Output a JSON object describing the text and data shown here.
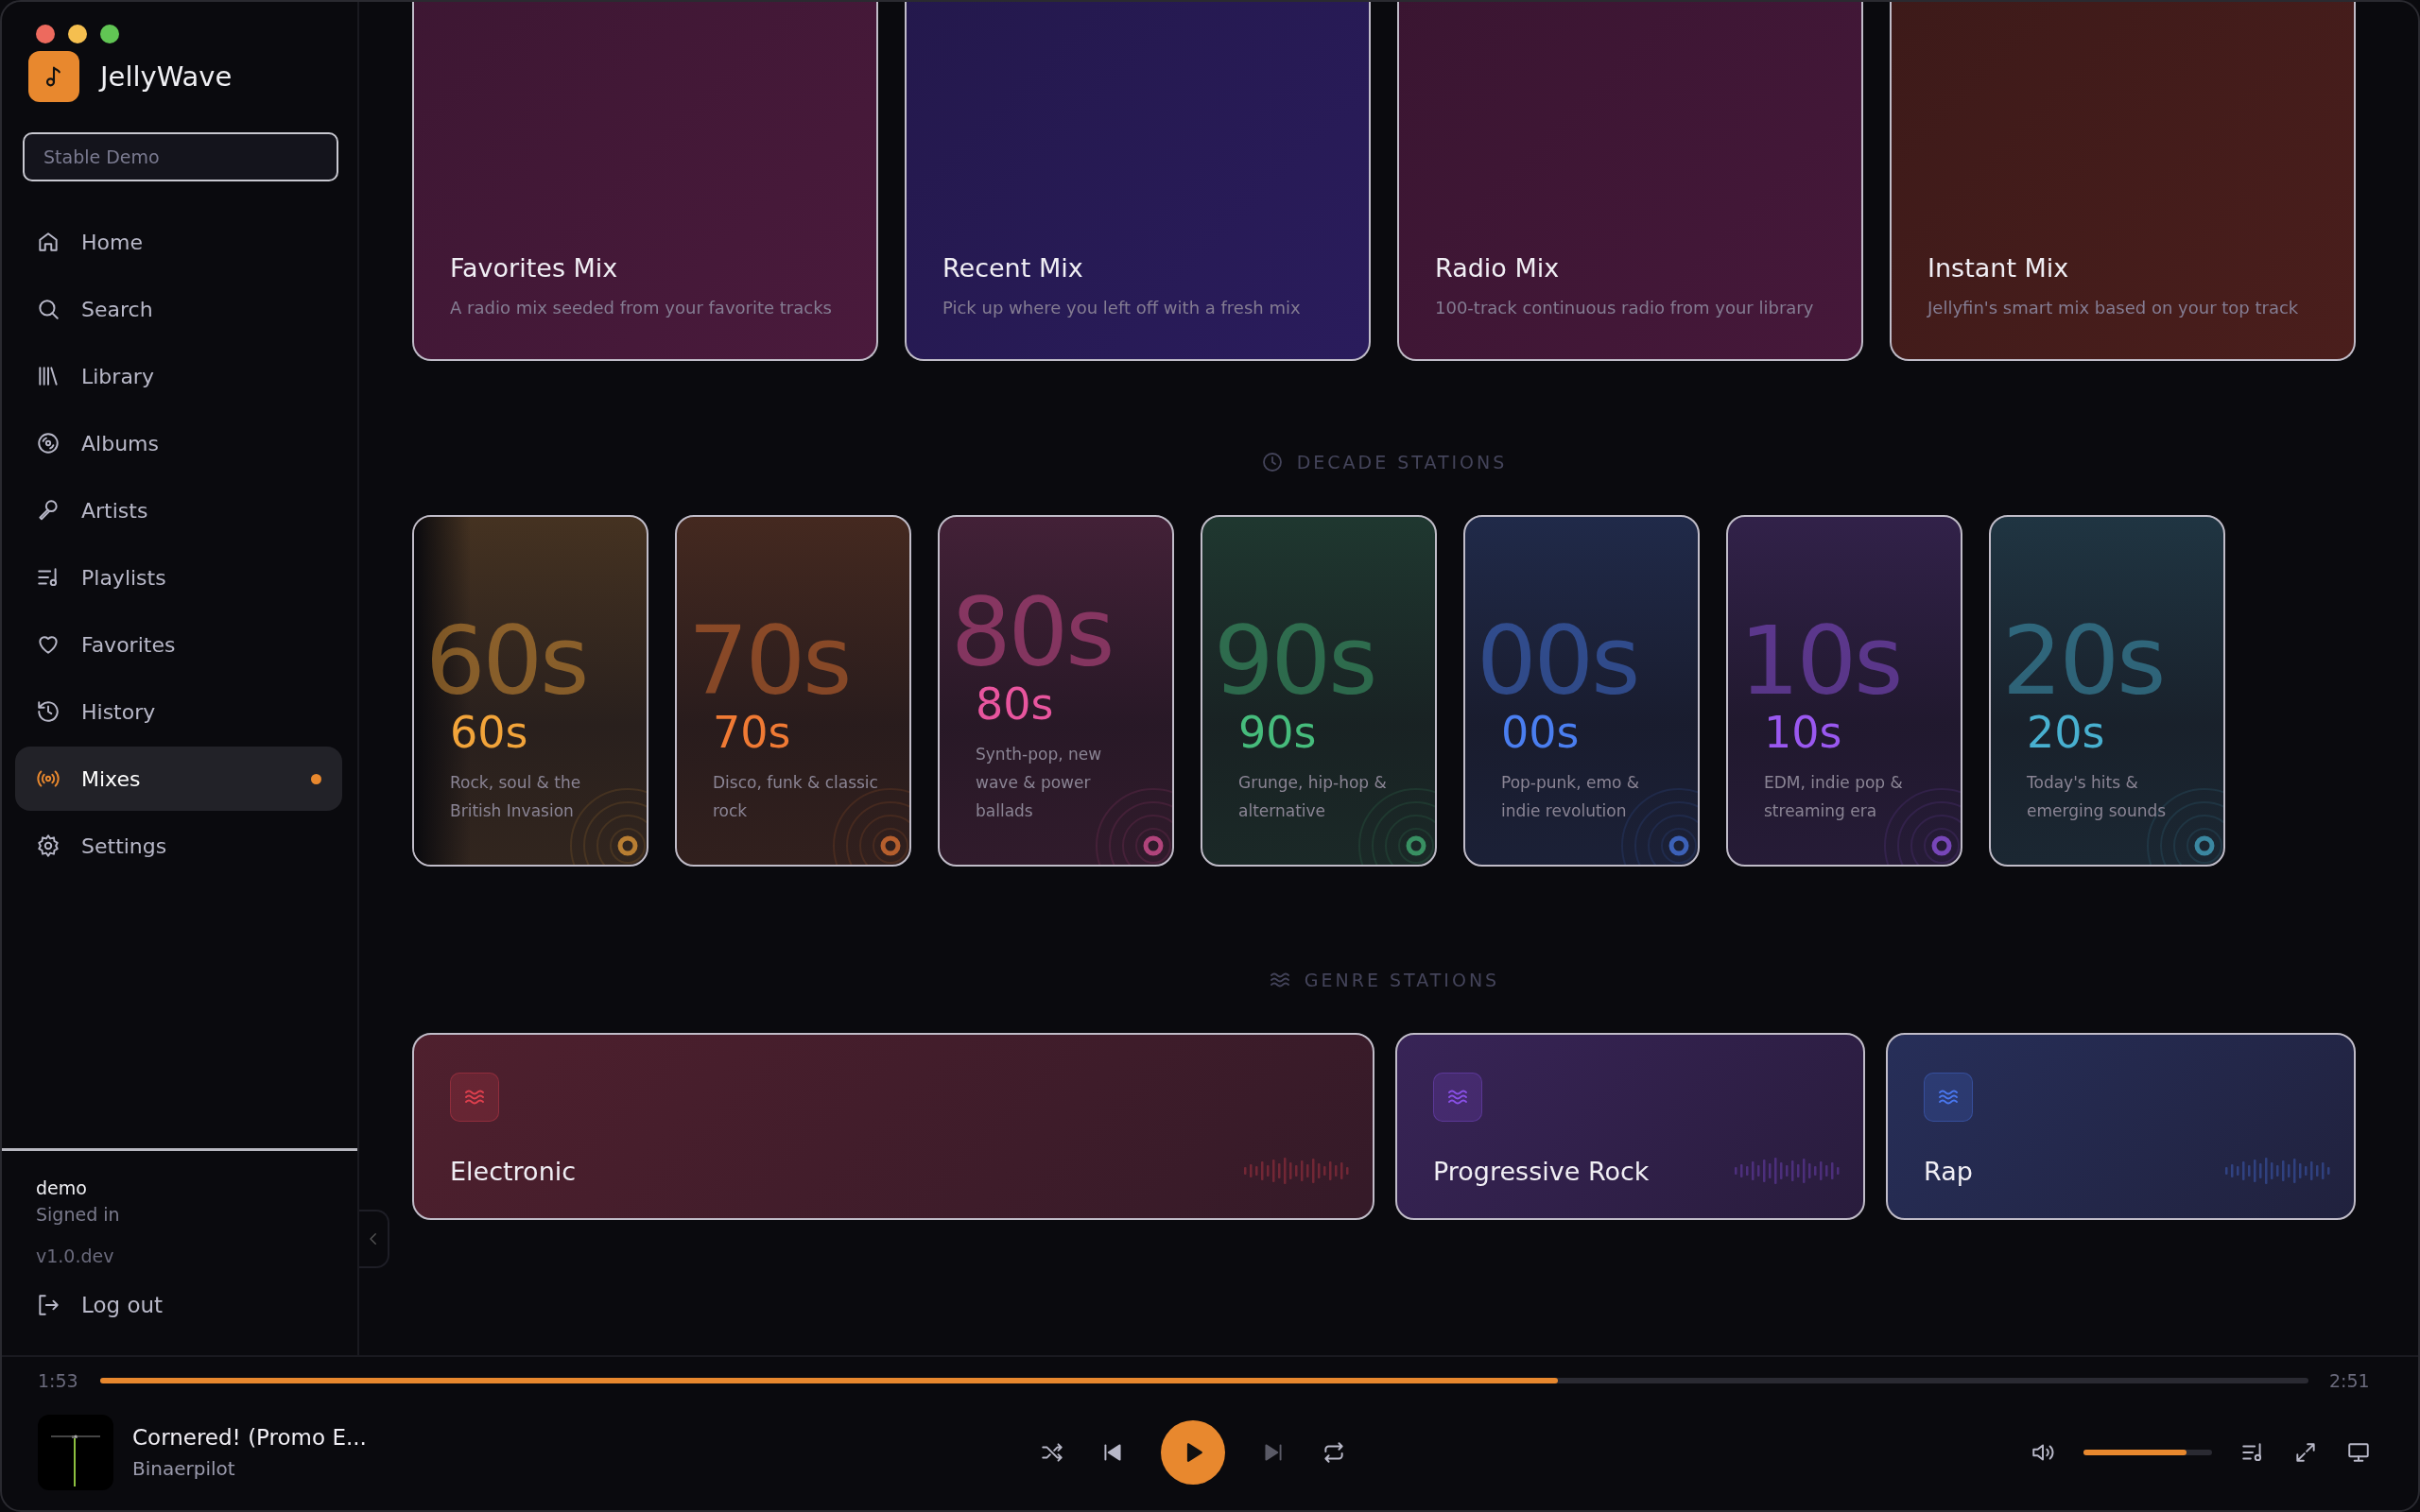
{
  "app": {
    "name": "JellyWave"
  },
  "server": {
    "placeholder": "Stable Demo"
  },
  "nav": [
    {
      "label": "Home",
      "selected": false,
      "dot": false
    },
    {
      "label": "Search",
      "selected": false,
      "dot": false
    },
    {
      "label": "Library",
      "selected": false,
      "dot": false
    },
    {
      "label": "Albums",
      "selected": false,
      "dot": false
    },
    {
      "label": "Artists",
      "selected": false,
      "dot": false
    },
    {
      "label": "Playlists",
      "selected": false,
      "dot": false
    },
    {
      "label": "Favorites",
      "selected": false,
      "dot": false
    },
    {
      "label": "History",
      "selected": false,
      "dot": false
    },
    {
      "label": "Mixes",
      "selected": true,
      "dot": true
    },
    {
      "label": "Settings",
      "selected": false,
      "dot": false
    }
  ],
  "account": {
    "user": "demo",
    "status": "Signed in",
    "version": "v1.0.dev",
    "logout": "Log out"
  },
  "mixes": [
    {
      "title": "Favorites Mix",
      "description": "A radio mix seeded from your favorite tracks",
      "color": "#4a1a3c"
    },
    {
      "title": "Recent Mix",
      "description": "Pick up where you left off with a fresh mix",
      "color": "#2a1c5c"
    },
    {
      "title": "Radio Mix",
      "description": "100-track continuous radio from your library",
      "color": "#46183a"
    },
    {
      "title": "Instant Mix",
      "description": "Jellyfin's smart mix based on your top track",
      "color": "#4a1e1c"
    }
  ],
  "decade_section": {
    "title": "DECADE STATIONS"
  },
  "decades": [
    {
      "backdrop": "60s",
      "label": "60s",
      "description": "Rock, soul & the British Invasion",
      "color": "#f2a43a"
    },
    {
      "backdrop": "70s",
      "label": "70s",
      "description": "Disco, funk & classic rock",
      "color": "#f07a34"
    },
    {
      "backdrop": "80s",
      "label": "80s",
      "description": "Synth-pop, new wave & power ballads",
      "color": "#e8559e"
    },
    {
      "backdrop": "90s",
      "label": "90s",
      "description": "Grunge, hip-hop & alternative",
      "color": "#46bc7c"
    },
    {
      "backdrop": "00s",
      "label": "00s",
      "description": "Pop-punk, emo & indie revolution",
      "color": "#4a7ef0"
    },
    {
      "backdrop": "10s",
      "label": "10s",
      "description": "EDM, indie pop & streaming era",
      "color": "#9a58f0"
    },
    {
      "backdrop": "20s",
      "label": "20s",
      "description": "Today's hits & emerging sounds",
      "color": "#48b0d0"
    }
  ],
  "genre_section": {
    "title": "GENRE STATIONS"
  },
  "genres": [
    {
      "name": "Electronic",
      "color": "#e0404e"
    },
    {
      "name": "Progressive Rock",
      "color": "#8a50e8"
    },
    {
      "name": "Rap",
      "color": "#4a78f0"
    }
  ],
  "player": {
    "elapsed": "1:53",
    "duration": "2:51",
    "level": 0.66,
    "title": "Cornered! (Promo E...",
    "artist": "Binaerpilot",
    "volume": {
      "level": 0.8
    }
  }
}
